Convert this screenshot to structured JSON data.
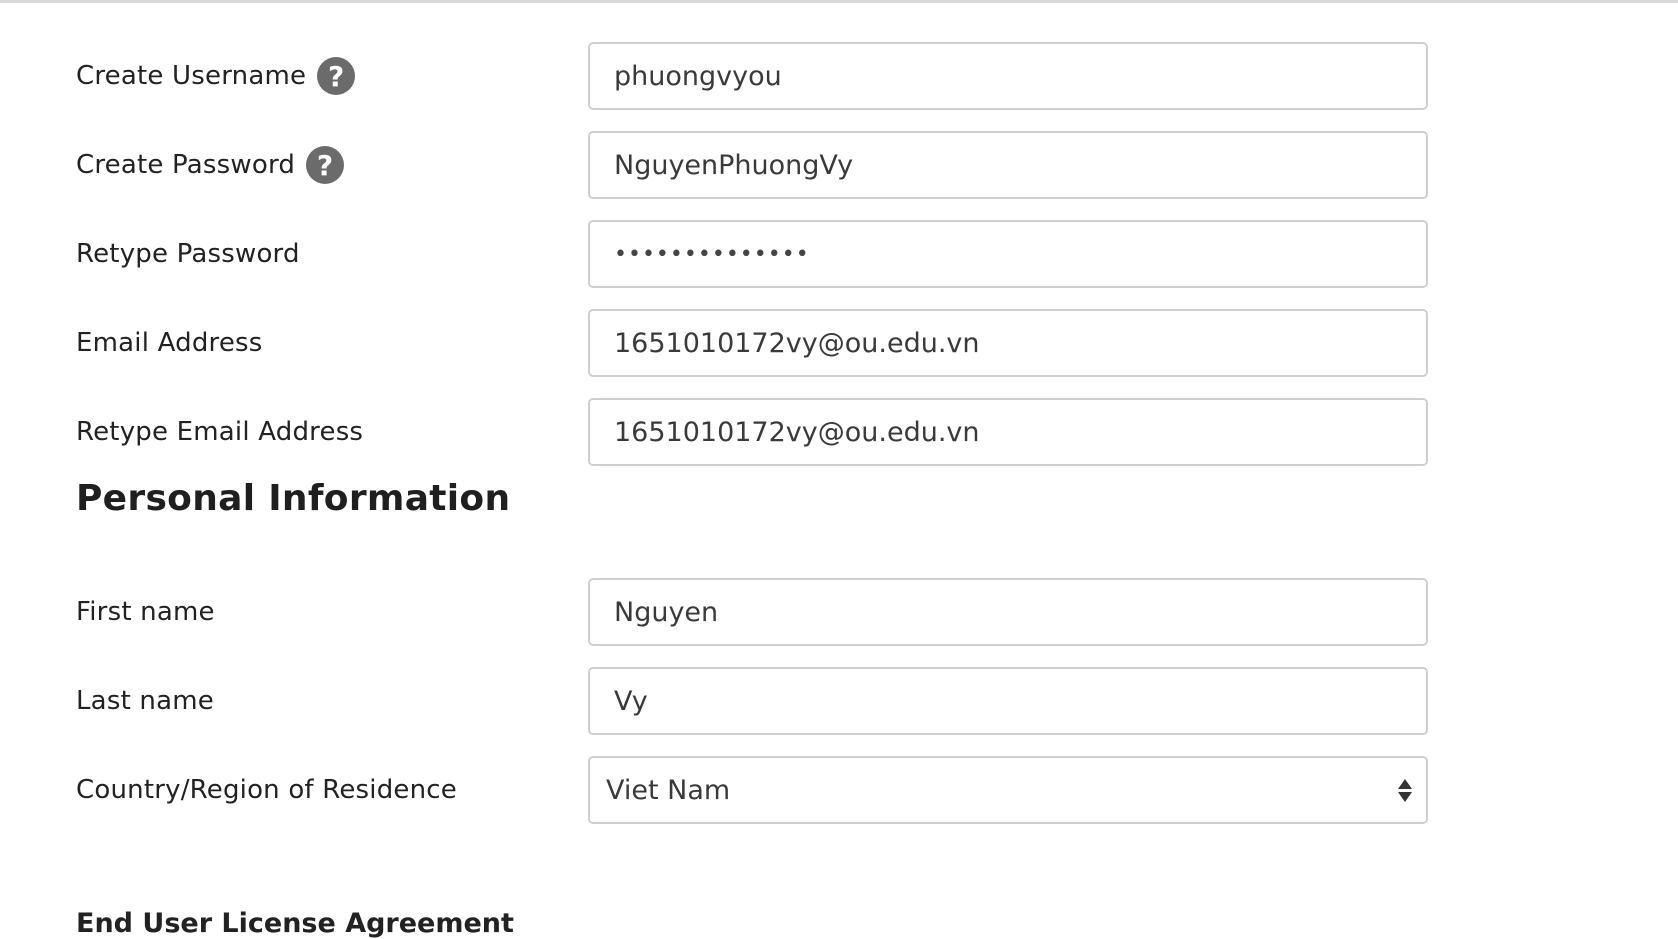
{
  "account": {
    "username": {
      "label": "Create Username",
      "value": "phuongvyou",
      "help_icon": "question-circle-icon"
    },
    "password": {
      "label": "Create Password",
      "value": "NguyenPhuongVy",
      "help_icon": "question-circle-icon"
    },
    "retype_password": {
      "label": "Retype Password",
      "value": "••••••••••••••"
    },
    "email": {
      "label": "Email Address",
      "value": "1651010172vy@ou.edu.vn"
    },
    "retype_email": {
      "label": "Retype Email Address",
      "value": "1651010172vy@ou.edu.vn"
    }
  },
  "personal": {
    "heading": "Personal Information",
    "first_name": {
      "label": "First name",
      "value": "Nguyen"
    },
    "last_name": {
      "label": "Last name",
      "value": "Vy"
    },
    "country": {
      "label": "Country/Region of Residence",
      "value": "Viet Nam",
      "icon": "select-arrows-icon"
    }
  },
  "eula": {
    "heading": "End User License Agreement"
  },
  "colors": {
    "help_icon": "#6b6b6b",
    "field_border": "#cfcfcf",
    "text": "#222222"
  }
}
